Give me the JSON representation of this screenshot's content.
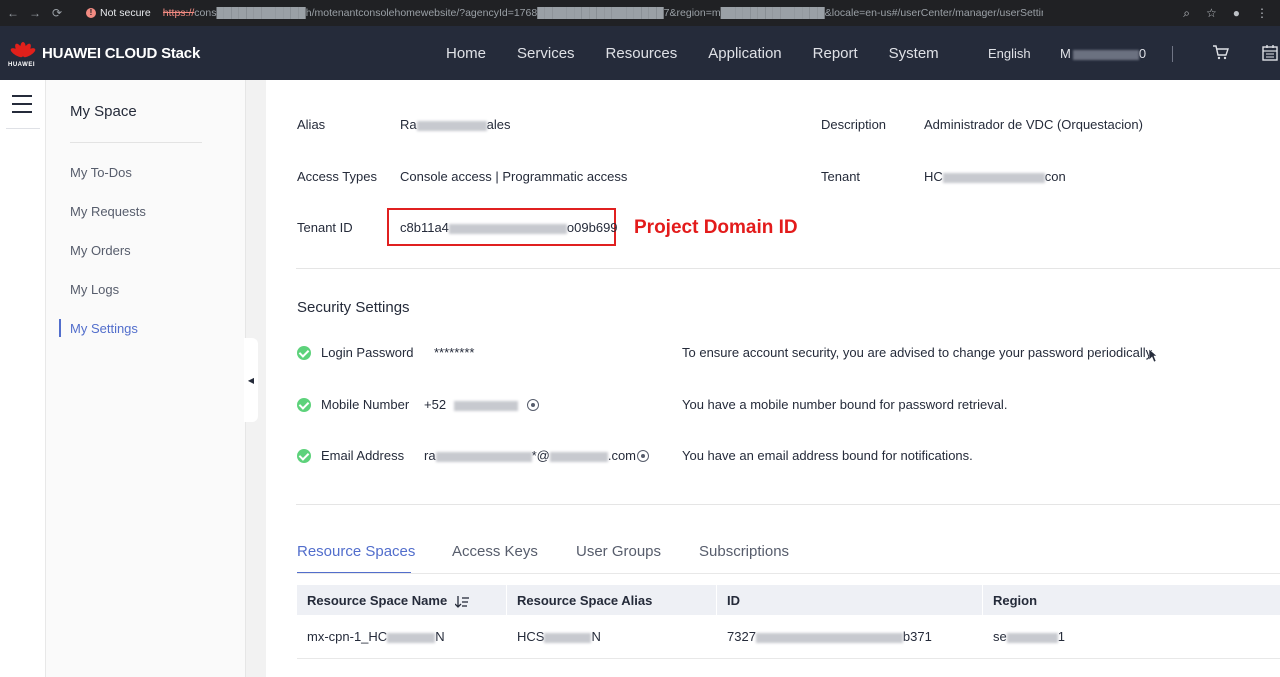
{
  "browser": {
    "security_label": "Not secure",
    "url_scheme": "https://",
    "url_rest": "cons████████████h/motenantconsolehomewebsite/?agencyId=1768█████████████████7&region=m██████████████&locale=en-us#/userCenter/manager/userSetting"
  },
  "topnav": {
    "logo_text": "HUAWEI CLOUD Stack",
    "logo_sub": "HUAWEI",
    "menu": [
      "Home",
      "Services",
      "Resources",
      "Application",
      "Report",
      "System"
    ],
    "language": "English",
    "user_prefix": "M",
    "user_suffix": "0"
  },
  "side": {
    "title": "My Space",
    "links": [
      "My To-Dos",
      "My Requests",
      "My Orders",
      "My Logs",
      "My Settings"
    ],
    "active": "My Settings"
  },
  "profile": {
    "alias_label": "Alias",
    "alias_prefix": "Ra",
    "alias_suffix": "ales",
    "access_types_label": "Access Types",
    "access_types_value": "Console access | Programmatic access",
    "tenant_id_label": "Tenant ID",
    "tenant_id_prefix": "c8b11a4",
    "tenant_id_suffix": "o09b699",
    "description_label": "Description",
    "description_value": "Administrador de VDC (Orquestacion)",
    "tenant_label": "Tenant",
    "tenant_prefix": "HC",
    "tenant_suffix": "con",
    "annotation": "Project Domain ID"
  },
  "security": {
    "title": "Security Settings",
    "items": [
      {
        "label": "Login Password",
        "value": "********",
        "hint": "To ensure account security, you are advised to change your password periodically."
      },
      {
        "label": "Mobile Number",
        "value": "+52",
        "hint": "You have a mobile number bound for password retrieval."
      },
      {
        "label": "Email Address",
        "value_prefix": "ra",
        "value_suffix": "*@",
        "value_end": ".com",
        "hint": "You have an email address bound for notifications."
      }
    ]
  },
  "tabs": [
    "Resource Spaces",
    "Access Keys",
    "User Groups",
    "Subscriptions"
  ],
  "table": {
    "columns": [
      "Resource Space Name",
      "Resource Space Alias",
      "ID",
      "Region"
    ],
    "rows": [
      {
        "name_prefix": "mx-cpn-1_HC",
        "name_suffix": "N",
        "alias_prefix": "HCS",
        "alias_suffix": "N",
        "id_prefix": "7327",
        "id_suffix": "b371",
        "region_prefix": "se",
        "region_suffix": "1"
      }
    ]
  },
  "colors": {
    "nav_bg": "#252b3a",
    "accent": "#526ecc",
    "annotation": "#e31b1b",
    "success": "#5dd27b"
  }
}
